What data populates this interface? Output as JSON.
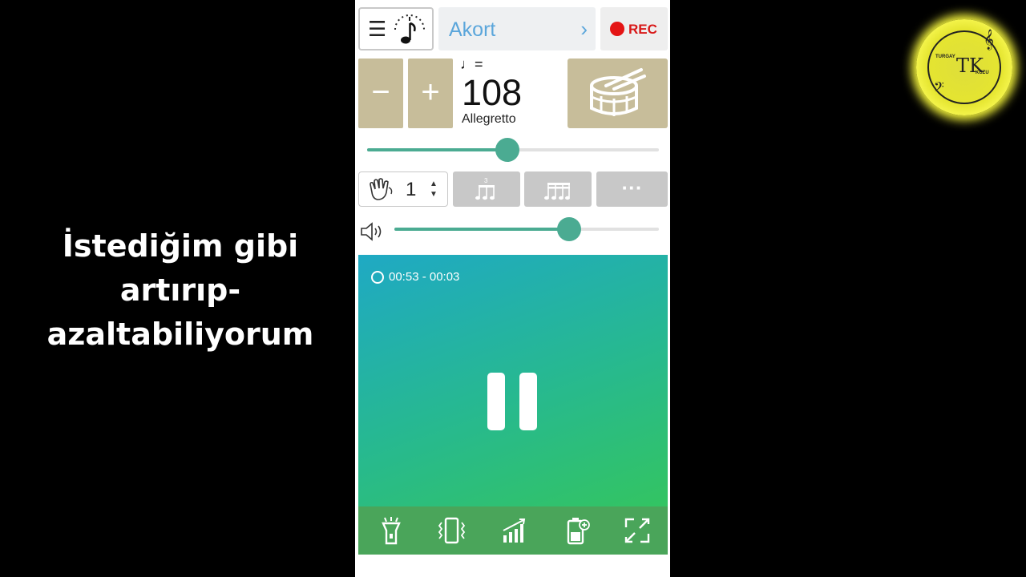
{
  "caption": {
    "line1": "İstediğim gibi",
    "line2": "artırıp-",
    "line3": "azaltabiliyorum"
  },
  "header": {
    "menu_icon": "hamburger-icon",
    "tuner_icon": "tuner-note-icon",
    "tuning_label": "Akort",
    "chevron": "›",
    "rec_label": "REC",
    "rec_color": "#e41414"
  },
  "tempo": {
    "minus_label": "−",
    "plus_label": "+",
    "note_symbol": "♩=",
    "bpm": "108",
    "tempo_name": "Allegretto",
    "slider_fraction": 0.48
  },
  "beats": {
    "beat_icon": "hand-clap-icon",
    "beat_count": "1",
    "more_label": "···",
    "subdivision_icons": [
      "triplet-icon",
      "sixteenth-notes-icon",
      "more-icon"
    ]
  },
  "volume": {
    "icon": "speaker-icon",
    "level_fraction": 0.66
  },
  "player": {
    "timer": "00:53 - 00:03",
    "accent": "#4bab92",
    "state": "pause-icon"
  },
  "toolbar": {
    "icons": [
      "flashlight-icon",
      "vibrate-icon",
      "signal-bars-icon",
      "battery-saver-icon",
      "fullscreen-icon"
    ]
  },
  "logo": {
    "top_text": "TURGAY",
    "bottom_text": "KUZU",
    "monogram": "TK"
  }
}
